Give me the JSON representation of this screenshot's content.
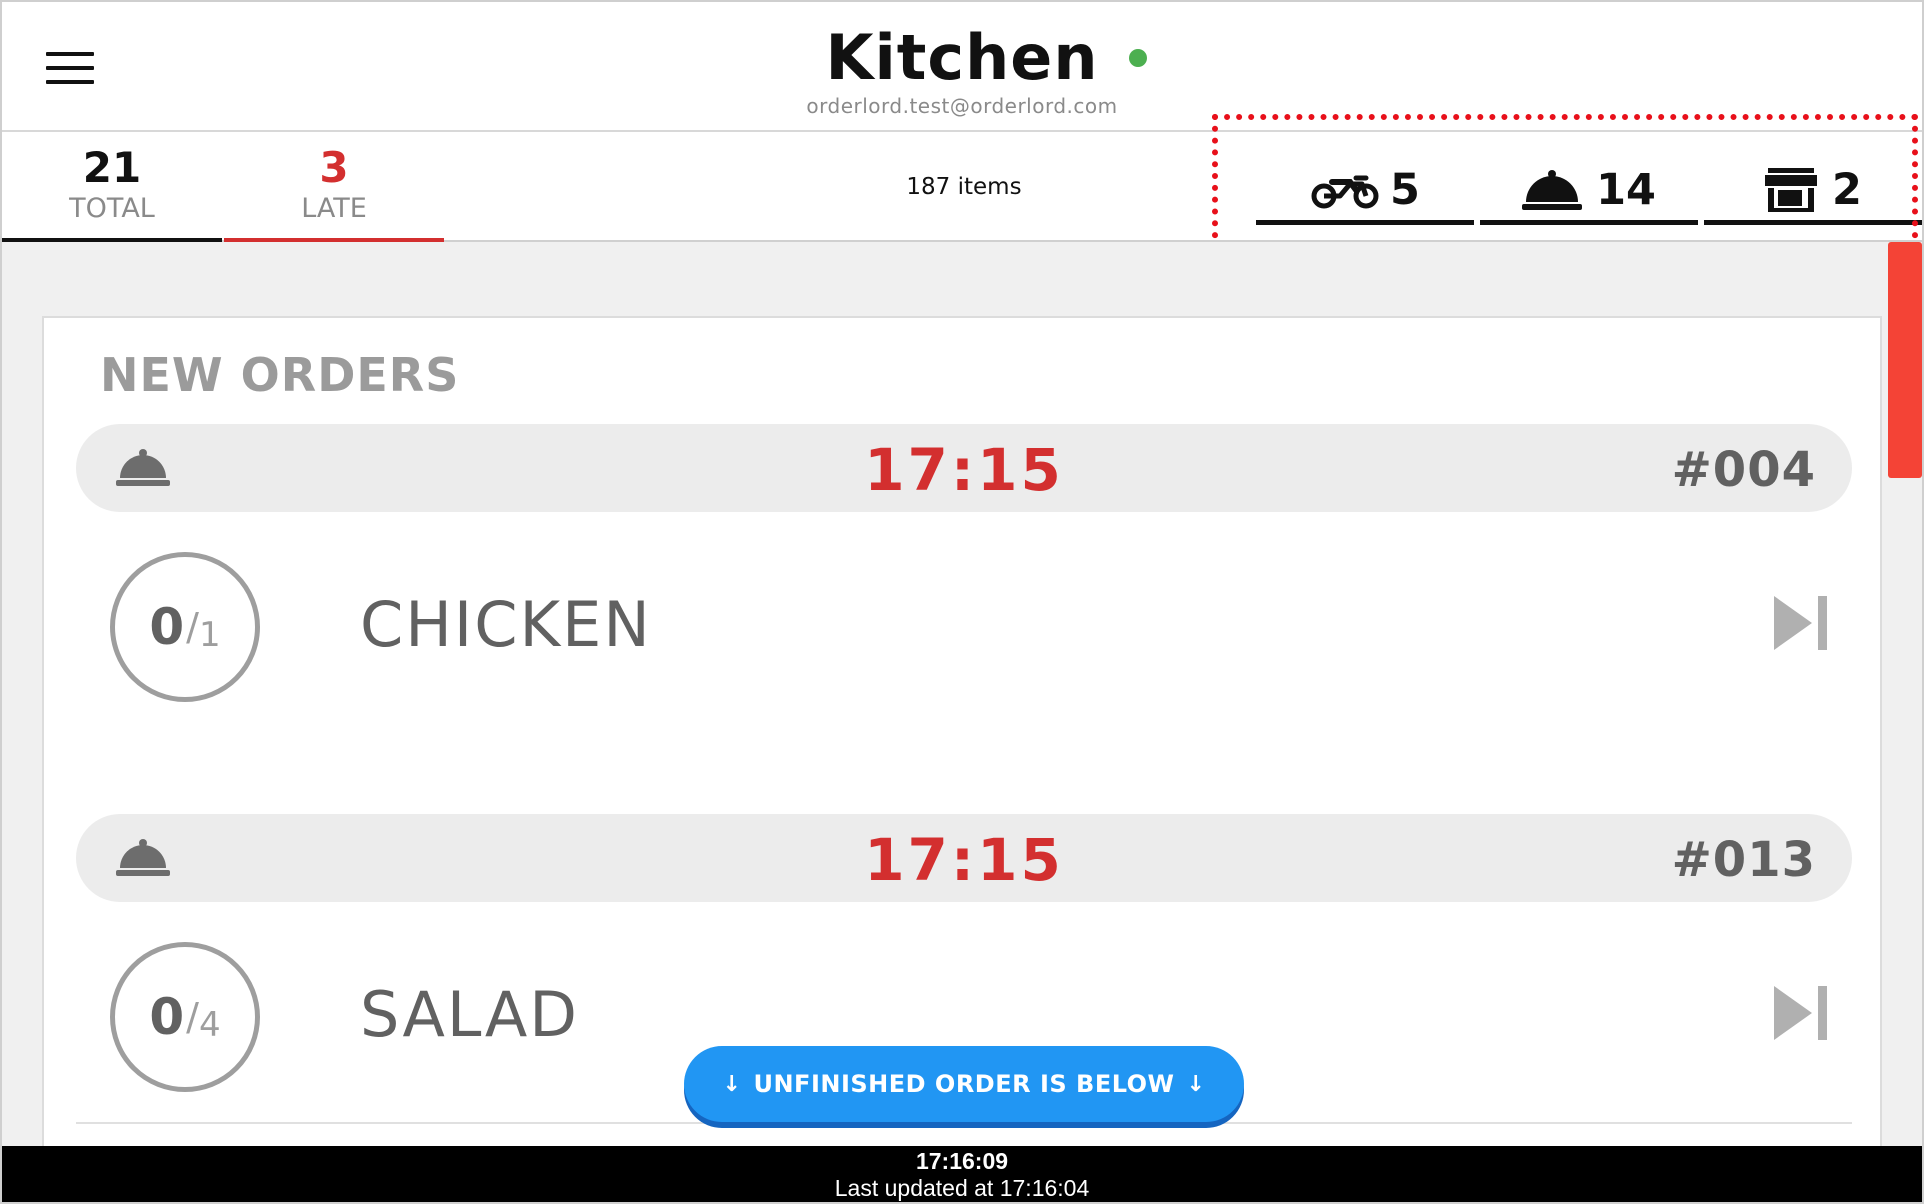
{
  "header": {
    "title": "Kitchen",
    "email": "orderlord.test@orderlord.com",
    "status_color": "#4caf50"
  },
  "stats": {
    "total": {
      "count": "21",
      "label": "TOTAL"
    },
    "late": {
      "count": "3",
      "label": "LATE"
    },
    "items_count": "187 items",
    "order_types": [
      {
        "icon": "motorcycle-icon",
        "count": "5"
      },
      {
        "icon": "cloche-icon",
        "count": "14"
      },
      {
        "icon": "store-icon",
        "count": "2"
      }
    ]
  },
  "colors": {
    "late": "#d32f2f",
    "accent_blue": "#2196f3",
    "highlight": "#e8101a"
  },
  "section": {
    "title": "NEW ORDERS"
  },
  "orders": [
    {
      "icon": "cloche-icon",
      "time": "17:15",
      "number": "#004",
      "item": {
        "name": "CHICKEN",
        "done": "0",
        "total": "1"
      }
    },
    {
      "icon": "cloche-icon",
      "time": "17:15",
      "number": "#013",
      "item": {
        "name": "SALAD",
        "done": "0",
        "total": "4"
      }
    }
  ],
  "unfinished_button": {
    "arrow": "↓",
    "label": "UNFINISHED ORDER IS BELOW"
  },
  "footer": {
    "clock": "17:16:09",
    "updated": "Last updated at 17:16:04"
  }
}
